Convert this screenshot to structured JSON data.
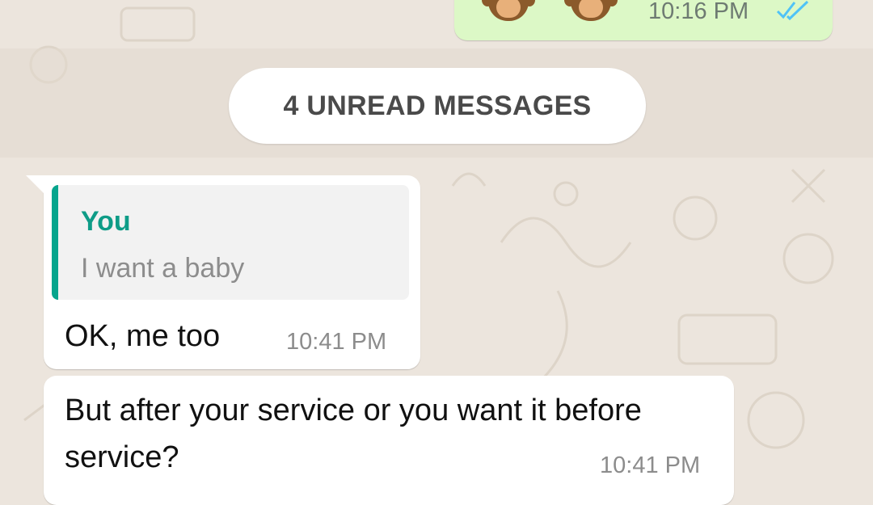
{
  "outgoing_message": {
    "emoji": [
      "monkey-face",
      "monkey-face"
    ],
    "time": "10:16 PM",
    "status_icon": "double-check-read-icon",
    "tick_color": "#4FC3F7"
  },
  "unread_divider": {
    "label": "4 UNREAD MESSAGES"
  },
  "messages": [
    {
      "quote": {
        "author": "You",
        "text": "I want a baby"
      },
      "text": "OK, me too",
      "time": "10:41 PM"
    },
    {
      "text": "But after your service or you want it before service?",
      "time": "10:41 PM"
    }
  ],
  "colors": {
    "background": "#ECE5DD",
    "outgoing_bubble": "#DCF8C6",
    "incoming_bubble": "#FFFFFF",
    "quote_accent": "#06A58D"
  }
}
